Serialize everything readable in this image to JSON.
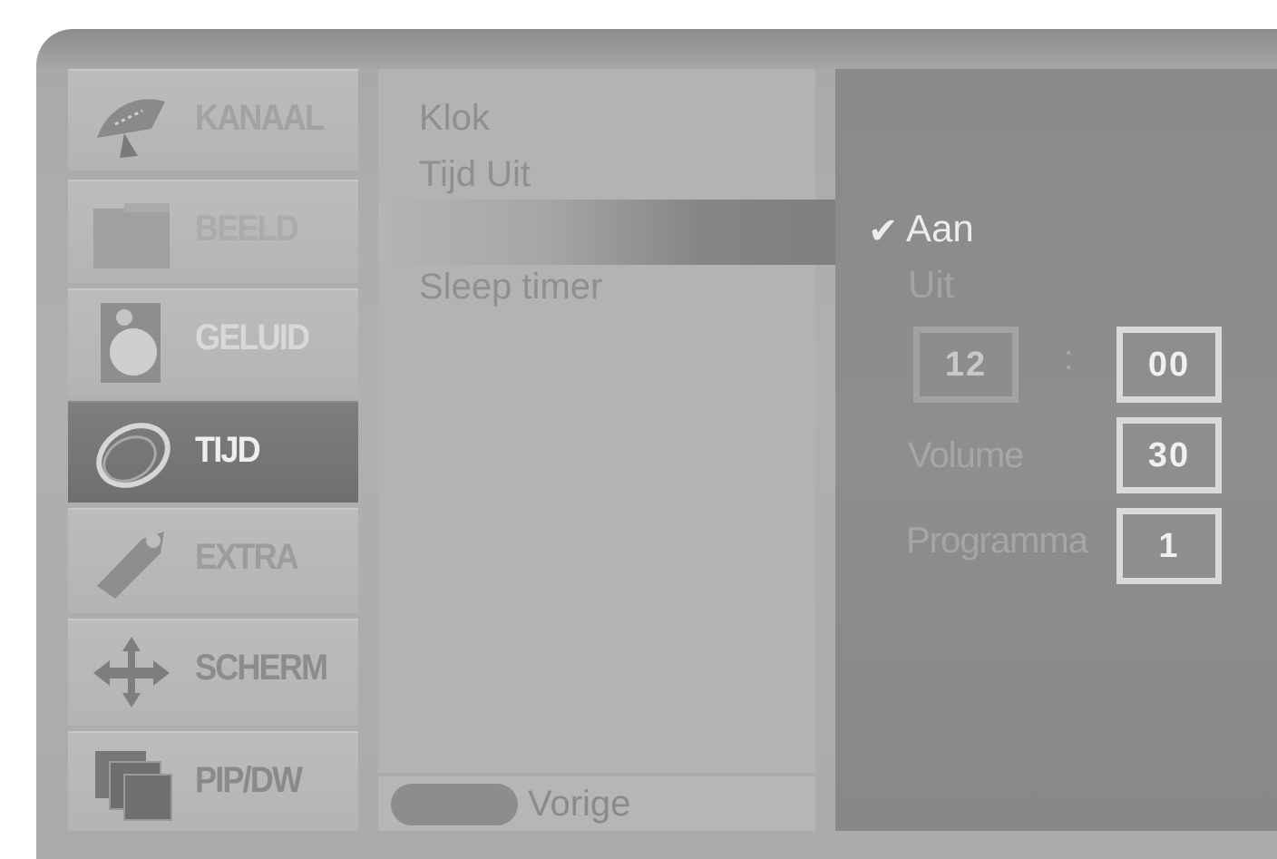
{
  "sidebar": {
    "items": [
      {
        "label": "KANAAL",
        "icon": "satellite-dish-icon"
      },
      {
        "label": "BEELD",
        "icon": "picture-icon"
      },
      {
        "label": "GELUID",
        "icon": "speaker-icon"
      },
      {
        "label": "TIJD",
        "icon": "clock-orbit-icon"
      },
      {
        "label": "EXTRA",
        "icon": "tag-icon"
      },
      {
        "label": "SCHERM",
        "icon": "arrows-cross-icon"
      },
      {
        "label": "PIP/DW",
        "icon": "pip-windows-icon"
      }
    ],
    "active": "TIJD"
  },
  "menu": {
    "items": [
      "Klok",
      "Tijd Uit",
      "",
      "Sleep timer"
    ],
    "back_label": "Vorige"
  },
  "options": {
    "on_label": "Aan",
    "off_label": "Uit",
    "selected": "Aan",
    "hour": "12",
    "colon": ":",
    "minute": "00",
    "volume_label": "Volume",
    "volume_value": "30",
    "program_label": "Programma",
    "program_value": "1"
  }
}
